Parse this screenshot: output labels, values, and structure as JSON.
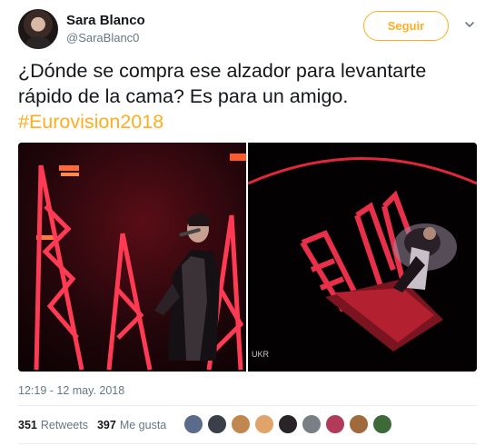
{
  "user": {
    "name": "Sara Blanco",
    "handle": "@SaraBlanc0",
    "follow_label": "Seguir"
  },
  "tweet": {
    "text": "¿Dónde se compra ese alzador para levantarte rápido de la cama? Es para un amigo.",
    "hashtag": "#Eurovision2018",
    "timestamp": "12:19 - 12 may. 2018"
  },
  "media": {
    "right_photo_tag": "UKR"
  },
  "stats": {
    "retweets_count": "351",
    "retweets_label": "Retweets",
    "likes_count": "397",
    "likes_label": "Me gusta"
  },
  "likers": [
    {
      "color": "#5a6b8c"
    },
    {
      "color": "#3a3f4a"
    },
    {
      "color": "#c2874e"
    },
    {
      "color": "#e0a36a"
    },
    {
      "color": "#2a2327"
    },
    {
      "color": "#7a7f86"
    },
    {
      "color": "#b23a5a"
    },
    {
      "color": "#a06a3c"
    },
    {
      "color": "#3e6a3a"
    }
  ],
  "colors": {
    "accent": "#ffad1f",
    "text": "#14171a",
    "secondary": "#657786"
  }
}
